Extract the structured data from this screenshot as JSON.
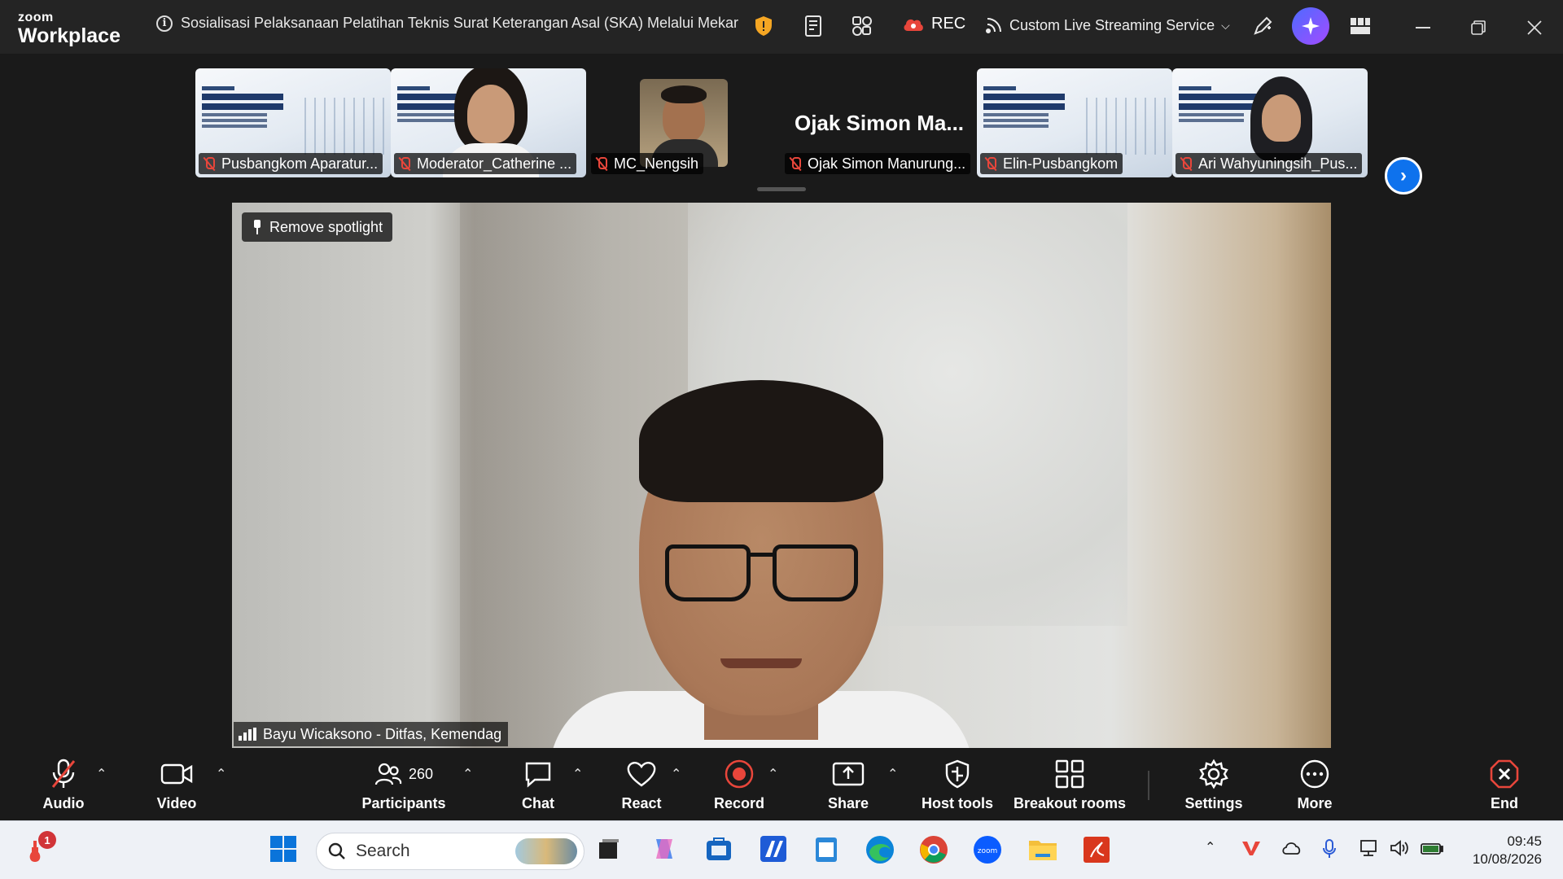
{
  "app": {
    "brand_top": "zoom",
    "brand_bottom": "Workplace"
  },
  "meeting": {
    "title": "Sosialisasi Pelaksanaan Pelatihan Teknis Surat Keterangan Asal (SKA) Melalui Mekar"
  },
  "titlebar": {
    "rec_label": "REC",
    "streaming_label": "Custom Live Streaming Service",
    "icons": [
      "shield-icon",
      "notes-icon",
      "apps-icon",
      "cloud-record-icon",
      "stream-icon",
      "whiteboard-pen-icon",
      "ai-companion-icon",
      "grid-view-icon"
    ],
    "window_controls": [
      "minimize-icon",
      "restore-icon",
      "close-icon"
    ]
  },
  "thumbnails": [
    {
      "name": "Pusbangkom Aparatur...",
      "type": "slide",
      "muted": true
    },
    {
      "name": "Moderator_Catherine ...",
      "type": "video",
      "muted": true
    },
    {
      "name": "MC_Nengsih",
      "type": "video",
      "muted": true
    },
    {
      "name": "Ojak Simon Manurung...",
      "display_name": "Ojak Simon Ma...",
      "type": "name",
      "muted": true
    },
    {
      "name": "Elin-Pusbangkom",
      "type": "slide",
      "muted": true
    },
    {
      "name": "Ari Wahyuningsih_Pus...",
      "type": "video",
      "muted": true
    }
  ],
  "main": {
    "spotlight_button": "Remove spotlight",
    "speaker_name": "Bayu Wicaksono - Ditfas, Kemendag"
  },
  "toolbar": {
    "audio": "Audio",
    "video": "Video",
    "participants": "Participants",
    "participants_count": "260",
    "chat": "Chat",
    "react": "React",
    "record": "Record",
    "share": "Share",
    "host_tools": "Host tools",
    "breakout_rooms": "Breakout rooms",
    "settings": "Settings",
    "more": "More",
    "end": "End"
  },
  "taskbar": {
    "search_placeholder": "Search",
    "notification_badge": "1",
    "time": "09:45",
    "date": "10/08/2026",
    "colors": {
      "accent": "#0e72ed",
      "record": "#e8463b",
      "end": "#e8463b"
    }
  }
}
